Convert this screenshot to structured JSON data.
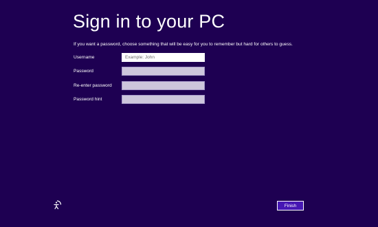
{
  "page": {
    "title": "Sign in to your PC",
    "intro": "If you want a password, choose something that will be easy for you to remember but hard for others to guess."
  },
  "form": {
    "fields": [
      {
        "label": "Username",
        "value": "",
        "placeholder": "Example: John"
      },
      {
        "label": "Password",
        "value": "",
        "placeholder": ""
      },
      {
        "label": "Re-enter password",
        "value": "",
        "placeholder": ""
      },
      {
        "label": "Password hint",
        "value": "",
        "placeholder": ""
      }
    ]
  },
  "footer": {
    "ease_of_access_icon": "ease-of-access-icon",
    "finish_label": "Finish"
  },
  "colors": {
    "background": "#1e0052",
    "text": "#ffffff",
    "field_inactive": "#cdc6dc",
    "field_active": "#ffffff",
    "button_background": "#4617b4"
  }
}
